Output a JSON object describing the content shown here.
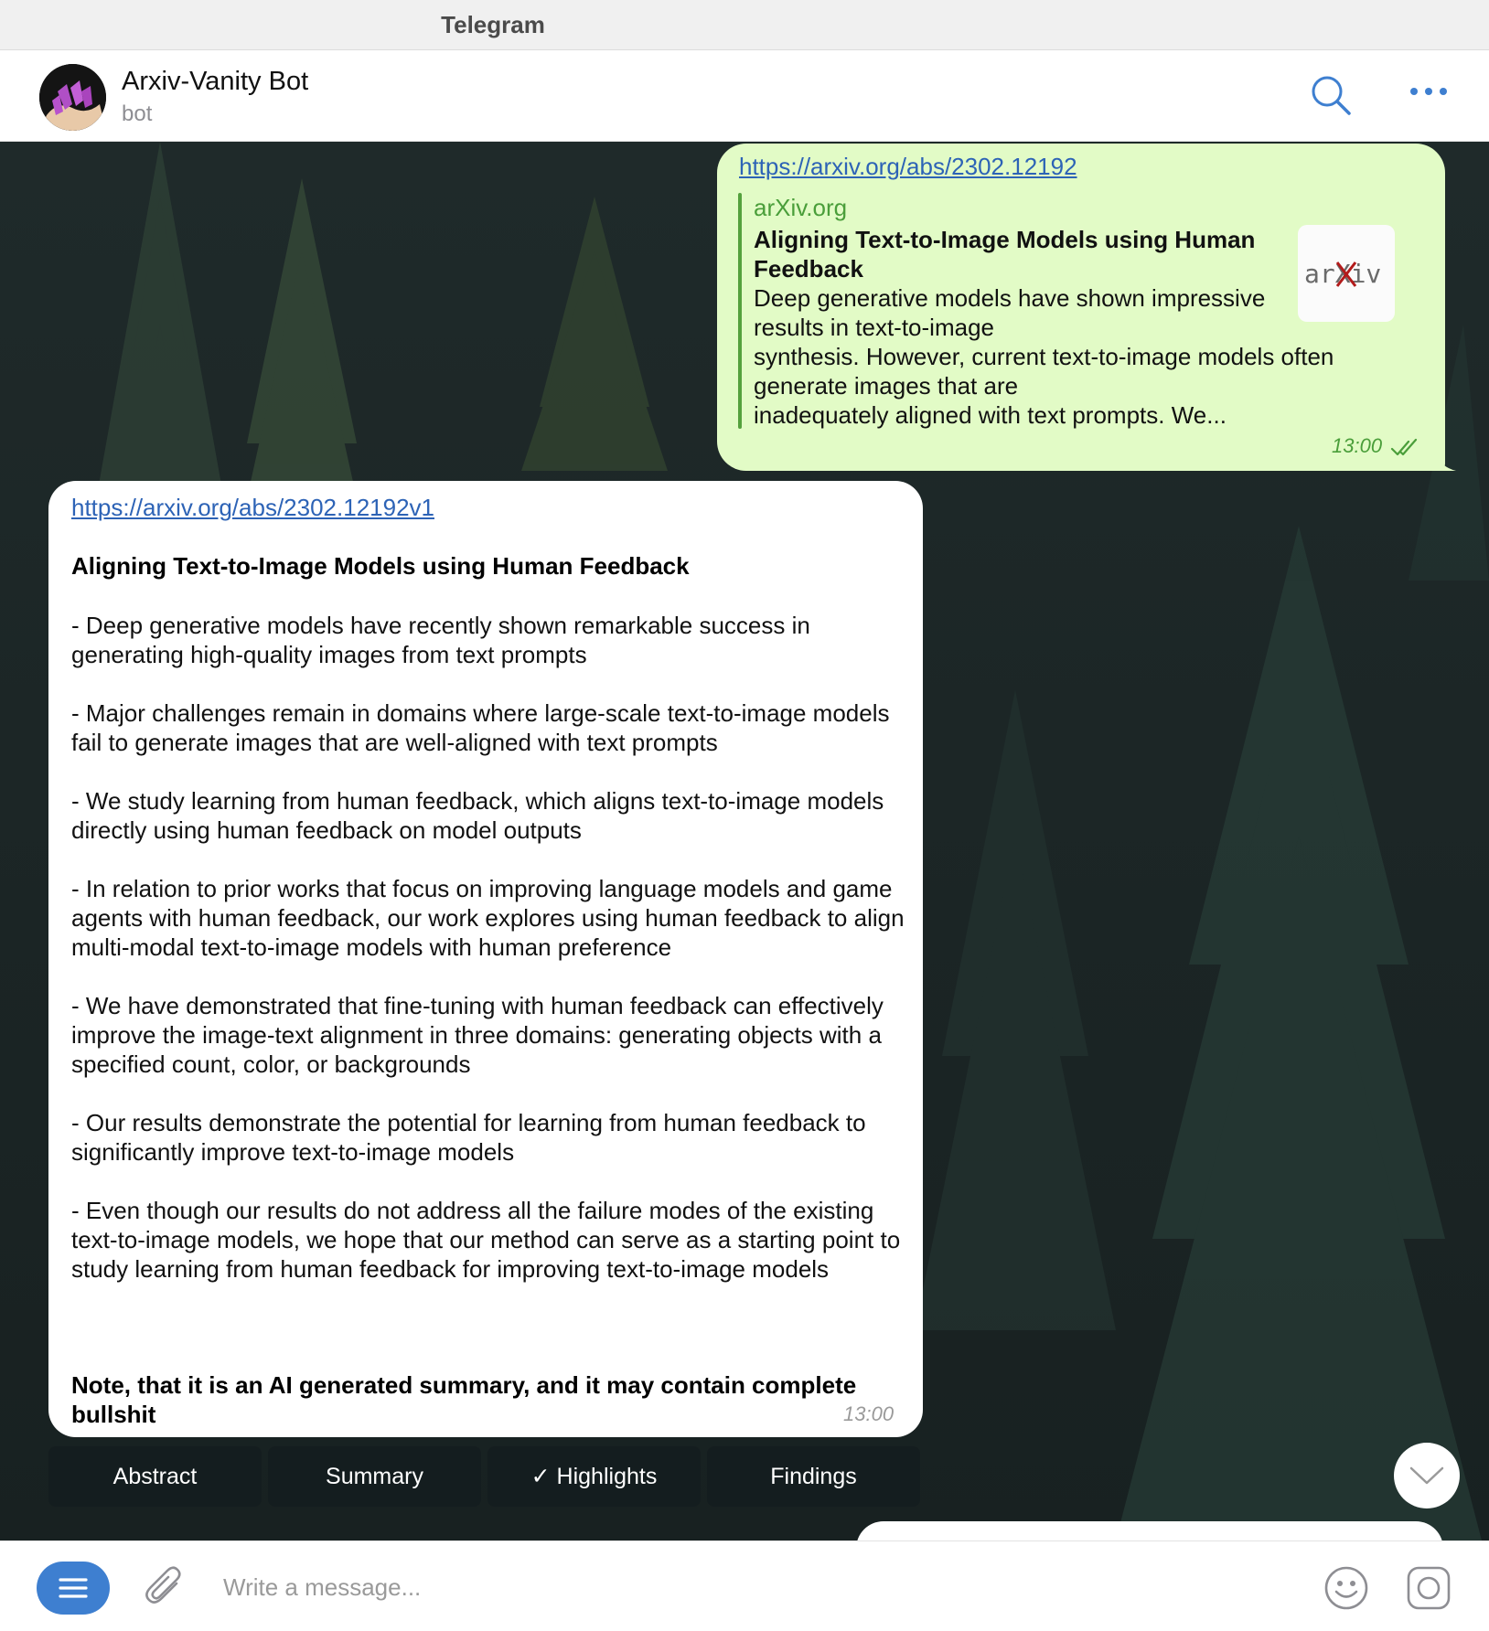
{
  "window": {
    "title": "Telegram"
  },
  "chat": {
    "name": "Arxiv-Vanity Bot",
    "status": "bot"
  },
  "outgoing_message": {
    "link": "https://arxiv.org/abs/2302.12192",
    "preview": {
      "site": "arXiv.org",
      "title": "Aligning Text-to-Image Models using Human Feedback",
      "description": "Deep generative models have shown impressive\nresults in text-to-image\nsynthesis. However, current text-to-image models often\ngenerate images that are\ninadequately aligned with text prompts. We...",
      "thumbnail_text": "arXiv"
    },
    "time": "13:00",
    "status": "read"
  },
  "incoming_message": {
    "link": "https://arxiv.org/abs/2302.12192v1",
    "title": "Aligning Text-to-Image Models using Human Feedback",
    "bullets": [
      "- Deep generative models have recently shown remarkable success in generating high-quality images from text prompts",
      "- Major challenges remain in domains where large-scale text-to-image models fail to generate images that are well-aligned with text prompts",
      "- We study learning from human feedback, which aligns text-to-image models directly using human feedback on model outputs",
      "- In relation to prior works that focus on improving language models and game agents with human feedback, our work explores using human feedback to align multi-modal text-to-image models with human preference",
      "- We have demonstrated that fine-tuning with human feedback can effectively improve the image-text alignment in three domains: generating objects with a specified count, color, or backgrounds",
      "- Our results demonstrate the potential for learning from human feedback to significantly improve text-to-image models",
      "- Even though our results do not address all the failure modes of the existing text-to-image models, we hope that our method can serve as a starting point to study learning from human feedback for improving text-to-image models"
    ],
    "note": "Note, that it is an AI generated summary, and it may contain complete bullshit",
    "time": "13:00"
  },
  "inline_keyboard": [
    {
      "label": "Abstract"
    },
    {
      "label": "Summary"
    },
    {
      "label": "✓ Highlights"
    },
    {
      "label": "Findings"
    }
  ],
  "composer": {
    "placeholder": "Write a message..."
  },
  "colors": {
    "accent": "#3e7fd0",
    "outgoing_bubble": "#e2fbc6",
    "preview_green": "#4a9e3a",
    "link": "#2d63b6"
  },
  "icons": {
    "header": [
      "search-icon",
      "more-icon"
    ],
    "composer": [
      "menu-icon",
      "attach-icon",
      "emoji-icon",
      "camera-icon"
    ],
    "misc": [
      "double-check-icon",
      "chevron-down-icon"
    ]
  }
}
